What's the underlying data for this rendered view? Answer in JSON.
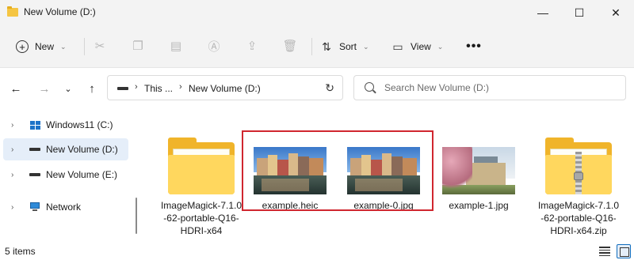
{
  "window": {
    "title": "New Volume (D:)",
    "minimize_glyph": "—",
    "maximize_glyph": "☐",
    "close_glyph": "✕"
  },
  "toolbar": {
    "new_label": "New",
    "sort_label": "Sort",
    "view_label": "View",
    "more_glyph": "•••"
  },
  "address": {
    "crumbs": [
      "This ...",
      "New Volume (D:)"
    ],
    "search_placeholder": "Search New Volume (D:)"
  },
  "sidebar": {
    "items": [
      {
        "label": "Windows11 (C:)",
        "icon": "windows-drive-icon",
        "selected": false
      },
      {
        "label": "New Volume (D:)",
        "icon": "drive-icon",
        "selected": true
      },
      {
        "label": "New Volume (E:)",
        "icon": "drive-icon",
        "selected": false
      },
      {
        "label": "Network",
        "icon": "network-icon",
        "selected": false
      }
    ]
  },
  "files": [
    {
      "name": "ImageMagick-7.1.0-62-portable-Q16-HDRI-x64",
      "type": "folder"
    },
    {
      "name": "example.heic",
      "type": "image"
    },
    {
      "name": "example-0.jpg",
      "type": "image"
    },
    {
      "name": "example-1.jpg",
      "type": "image"
    },
    {
      "name": "ImageMagick-7.1.0-62-portable-Q16-HDRI-x64.zip",
      "type": "zip"
    }
  ],
  "status": {
    "item_count": "5 items"
  },
  "colors": {
    "highlight": "#d0262f",
    "selection": "#e5eef9",
    "accent": "#0f6cbd"
  }
}
